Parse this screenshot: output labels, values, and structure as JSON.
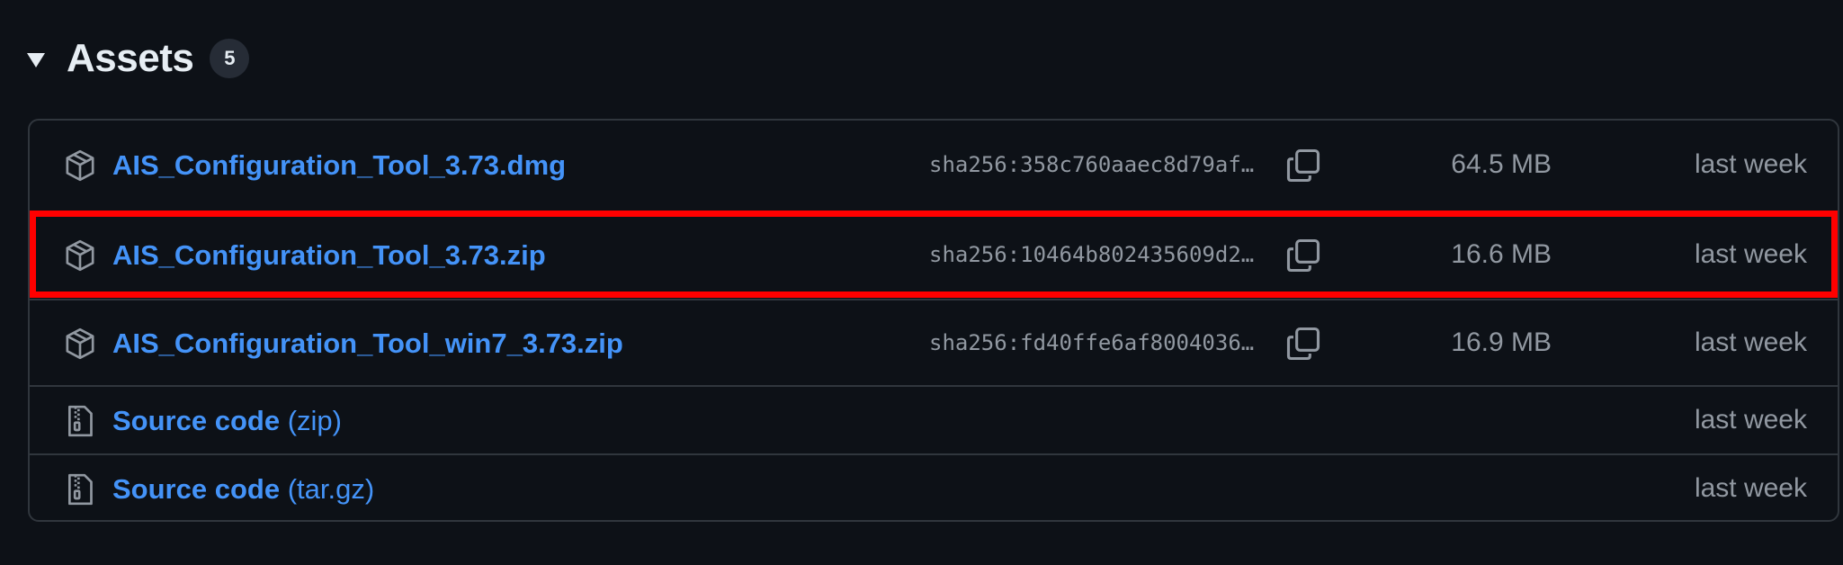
{
  "header": {
    "title": "Assets",
    "count": "5",
    "caret_icon": "triangle-down-icon"
  },
  "assets": [
    {
      "name": "AIS_Configuration_Tool_3.73.dmg",
      "suffix": "",
      "icon": "package-icon",
      "sha": "sha256:358c760aaec8d79af…",
      "size": "64.5 MB",
      "date": "last week"
    },
    {
      "name": "AIS_Configuration_Tool_3.73.zip",
      "suffix": "",
      "icon": "package-icon",
      "sha": "sha256:10464b802435609d2…",
      "size": "16.6 MB",
      "date": "last week"
    },
    {
      "name": "AIS_Configuration_Tool_win7_3.73.zip",
      "suffix": "",
      "icon": "package-icon",
      "sha": "sha256:fd40ffe6af8004036…",
      "size": "16.9 MB",
      "date": "last week"
    },
    {
      "name": "Source code",
      "suffix": "(zip)",
      "icon": "file-zip-icon",
      "date": "last week"
    },
    {
      "name": "Source code",
      "suffix": "(tar.gz)",
      "icon": "file-zip-icon",
      "date": "last week"
    }
  ],
  "colors": {
    "background": "#0d1117",
    "link": "#4493f8",
    "muted": "#9198a1",
    "border": "#30363d",
    "highlight": "#ff0000"
  }
}
